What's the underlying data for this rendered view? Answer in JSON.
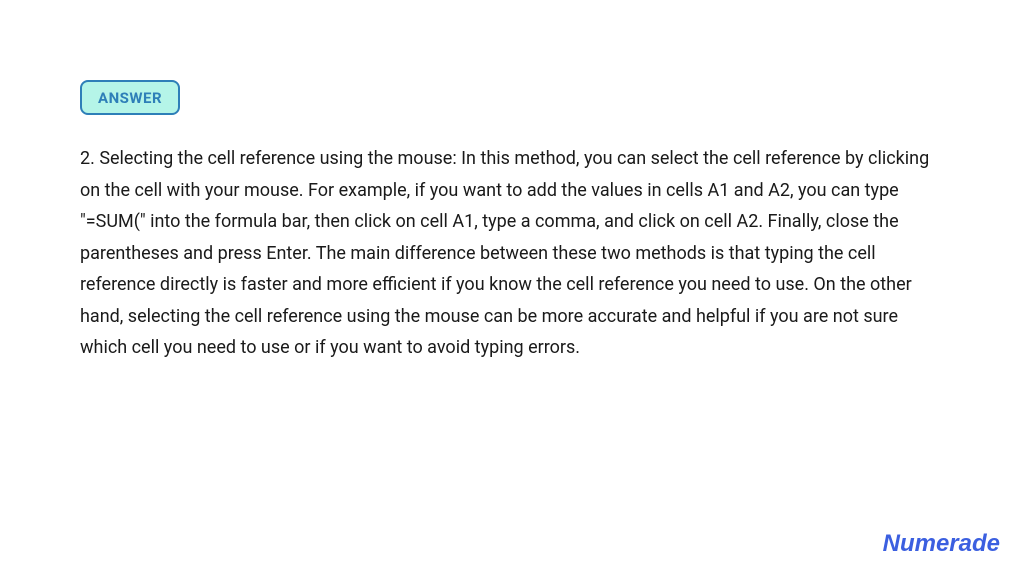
{
  "badge": {
    "label": "ANSWER"
  },
  "answer": {
    "text": "2. Selecting the cell reference using the mouse: In this method, you can select the cell reference by clicking on the cell with your mouse. For example, if you want to add the values in cells A1 and A2, you can type \"=SUM(\" into the formula bar, then click on cell A1, type a comma, and click on cell A2. Finally, close the parentheses and press Enter. The main difference between these two methods is that typing the cell reference directly is faster and more efficient if you know the cell reference you need to use. On the other hand, selecting the cell reference using the mouse can be more accurate and helpful if you are not sure which cell you need to use or if you want to avoid typing errors."
  },
  "brand": {
    "name": "Numerade"
  }
}
